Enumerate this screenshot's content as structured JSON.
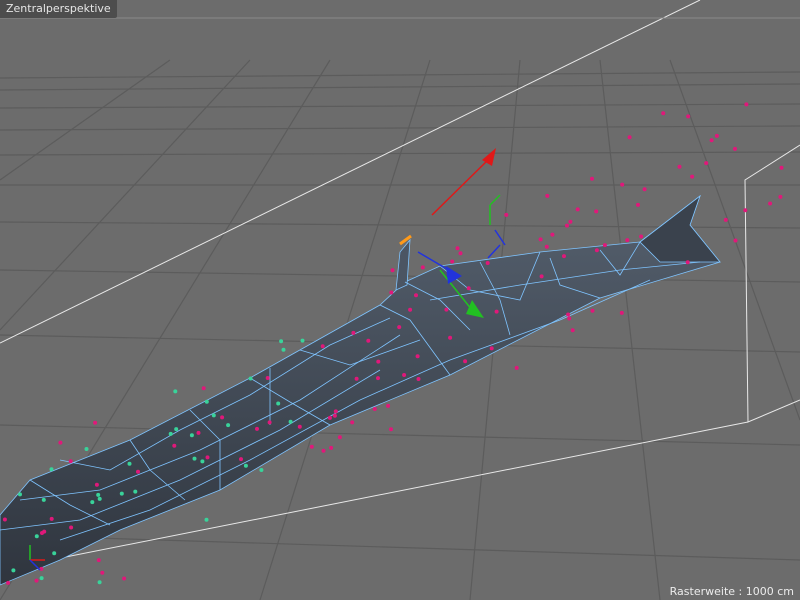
{
  "viewport": {
    "title": "Zentralperspektive",
    "grid_info": "Rasterweite : 1000 cm"
  },
  "colors": {
    "background": "#6c6c6c",
    "grid_line": "#5a5a5a",
    "bounding_box": "#e8e8e8",
    "object_surface": "#3e4550",
    "mesh_edges": "#7fc4ff",
    "particle_magenta": "#e0187a",
    "particle_green": "#39d39a",
    "axis_x": "#e01818",
    "axis_y": "#22c022",
    "axis_z": "#2233dd",
    "handle_orange": "#ff9a1a"
  },
  "icons": [
    "world-axis-icon",
    "move-gizmo-icon",
    "object-axis-icon"
  ]
}
